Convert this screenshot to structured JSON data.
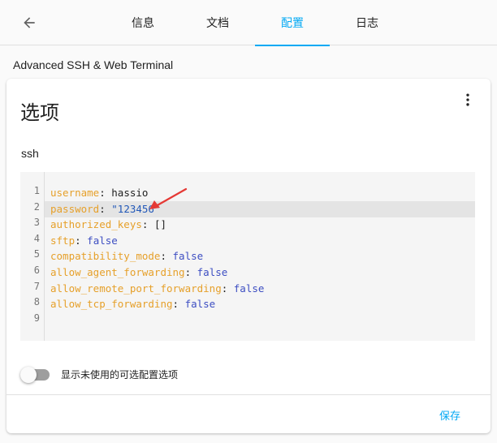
{
  "header": {
    "tabs": [
      {
        "label": "信息",
        "active": false
      },
      {
        "label": "文档",
        "active": false
      },
      {
        "label": "配置",
        "active": true
      },
      {
        "label": "日志",
        "active": false
      }
    ],
    "back_icon": "arrow-left-icon"
  },
  "addon": {
    "name": "Advanced SSH & Web Terminal"
  },
  "card": {
    "title": "选项",
    "menu_icon": "dots-vertical-icon",
    "section_label": "ssh",
    "editor": {
      "lines": [
        {
          "num": "1",
          "key": "username",
          "sep": ": ",
          "value": "hassio",
          "value_type": "plain"
        },
        {
          "num": "2",
          "key": "password",
          "sep": ": ",
          "value": "\"123456\"",
          "value_type": "string"
        },
        {
          "num": "3",
          "key": "authorized_keys",
          "sep": ": ",
          "value": "[]",
          "value_type": "plain"
        },
        {
          "num": "4",
          "key": "sftp",
          "sep": ": ",
          "value": "false",
          "value_type": "bool"
        },
        {
          "num": "5",
          "key": "compatibility_mode",
          "sep": ": ",
          "value": "false",
          "value_type": "bool"
        },
        {
          "num": "6",
          "key": "allow_agent_forwarding",
          "sep": ": ",
          "value": "false",
          "value_type": "bool"
        },
        {
          "num": "7",
          "key": "allow_remote_port_forwarding",
          "sep": ": ",
          "value": "false",
          "value_type": "bool"
        },
        {
          "num": "8",
          "key": "allow_tcp_forwarding",
          "sep": ": ",
          "value": "false",
          "value_type": "bool"
        },
        {
          "num": "9",
          "key": "",
          "sep": "",
          "value": "",
          "value_type": "plain"
        }
      ],
      "active_line": 2
    },
    "toggle": {
      "label": "显示未使用的可选配置选项",
      "checked": false
    },
    "save_label": "保存"
  },
  "colors": {
    "accent": "#03a9f4",
    "yaml_key": "#e6a02a",
    "yaml_bool": "#3d4ec2",
    "yaml_string": "#2258b8",
    "annotation_arrow": "#e53935"
  }
}
